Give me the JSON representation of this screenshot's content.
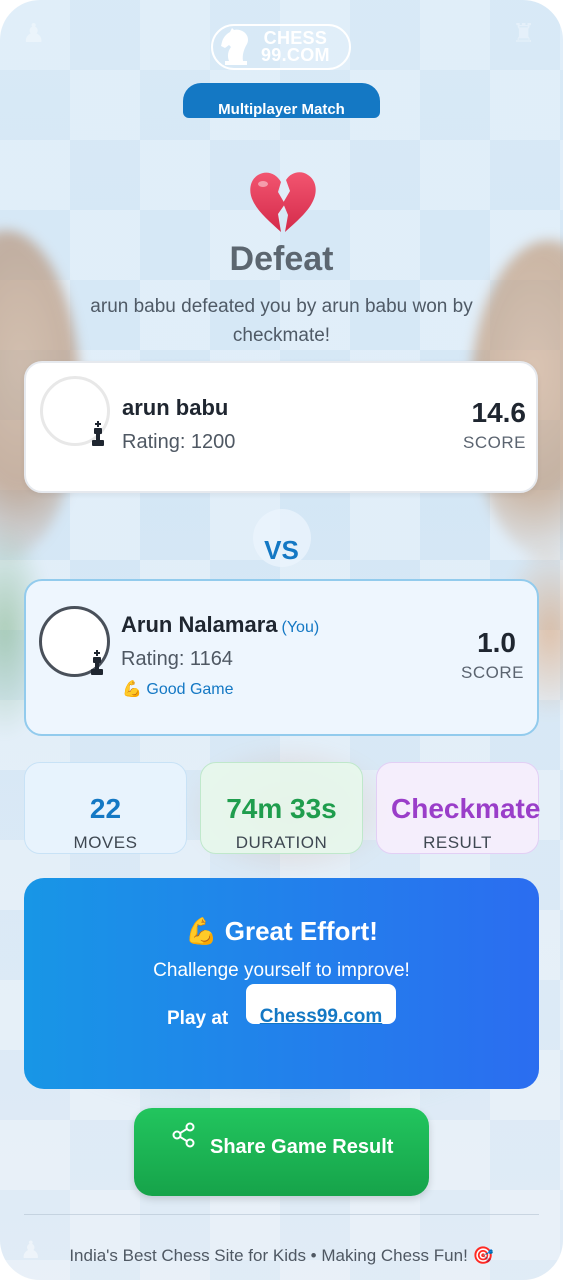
{
  "brand": {
    "line1": "CHESS",
    "line2": "99.COM"
  },
  "mode_label": "Multiplayer Match",
  "result": {
    "title": "Defeat",
    "subtitle": "arun babu defeated you by arun babu won by checkmate!",
    "icon": "broken-heart-icon"
  },
  "opponent": {
    "name": "arun babu",
    "rating": "Rating: 1200",
    "score": "14.6",
    "score_label": "SCORE"
  },
  "vs_label": "VS",
  "player": {
    "name": "Arun Nalamara",
    "you_tag": "(You)",
    "rating": "Rating: 1164",
    "badge_emoji": "💪",
    "badge": "Good Game",
    "score": "1.0",
    "score_label": "SCORE"
  },
  "stats": [
    {
      "value": "22",
      "label": "MOVES"
    },
    {
      "value": "74m 33s",
      "label": "DURATION"
    },
    {
      "value": "Checkmate",
      "label": "RESULT"
    }
  ],
  "promo": {
    "emoji": "💪",
    "title": "Great Effort!",
    "subtitle": "Challenge yourself to improve!",
    "play_label": "Play at",
    "link": "Chess99.com"
  },
  "share_label": "Share Game Result",
  "footer": "India's Best Chess Site for Kids • Making Chess Fun! 🎯",
  "colors": {
    "accent": "#1478c4",
    "defeat": "#5c6670",
    "success": "#1f9d4d",
    "purple": "#9a3ec9",
    "promo_start": "#1896e6",
    "promo_end": "#2b6df0"
  }
}
